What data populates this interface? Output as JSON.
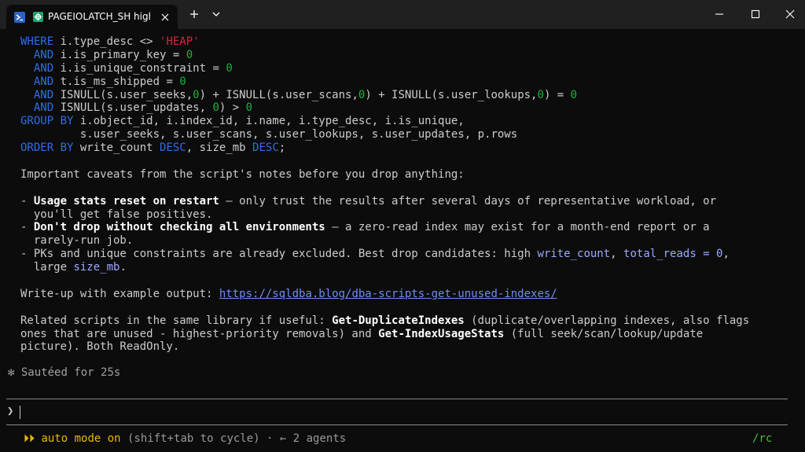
{
  "window": {
    "tab_title": "PAGEIOLATCH_SH high lat",
    "icons": [
      "powershell-icon",
      "task-status-icon",
      "close-icon",
      "plus-icon",
      "chevron-down-icon",
      "minimize-icon",
      "maximize-icon",
      "window-close-icon"
    ]
  },
  "code": [
    [
      [
        "kw",
        "WHERE"
      ],
      [
        "pl",
        " i.type_desc <> "
      ],
      [
        "str",
        "'HEAP'"
      ]
    ],
    [
      [
        "pl",
        "  "
      ],
      [
        "kw",
        "AND"
      ],
      [
        "pl",
        " i.is_primary_key = "
      ],
      [
        "num",
        "0"
      ]
    ],
    [
      [
        "pl",
        "  "
      ],
      [
        "kw",
        "AND"
      ],
      [
        "pl",
        " i.is_unique_constraint = "
      ],
      [
        "num",
        "0"
      ]
    ],
    [
      [
        "pl",
        "  "
      ],
      [
        "kw",
        "AND"
      ],
      [
        "pl",
        " t.is_ms_shipped = "
      ],
      [
        "num",
        "0"
      ]
    ],
    [
      [
        "pl",
        "  "
      ],
      [
        "kw",
        "AND"
      ],
      [
        "pl",
        " ISNULL(s.user_seeks,"
      ],
      [
        "num",
        "0"
      ],
      [
        "pl",
        ") + ISNULL(s.user_scans,"
      ],
      [
        "num",
        "0"
      ],
      [
        "pl",
        ") + ISNULL(s.user_lookups,"
      ],
      [
        "num",
        "0"
      ],
      [
        "pl",
        ") = "
      ],
      [
        "num",
        "0"
      ]
    ],
    [
      [
        "pl",
        "  "
      ],
      [
        "kw",
        "AND"
      ],
      [
        "pl",
        " ISNULL(s.user_updates, "
      ],
      [
        "num",
        "0"
      ],
      [
        "pl",
        ") > "
      ],
      [
        "num",
        "0"
      ]
    ],
    [
      [
        "kw",
        "GROUP BY"
      ],
      [
        "pl",
        " i.object_id, i.index_id, i.name, i.type_desc, i.is_unique,"
      ]
    ],
    [
      [
        "pl",
        "         s.user_seeks, s.user_scans, s.user_lookups, s.user_updates, p.rows"
      ]
    ],
    [
      [
        "kw",
        "ORDER BY"
      ],
      [
        "pl",
        " write_count "
      ],
      [
        "kw",
        "DESC"
      ],
      [
        "pl",
        ", size_mb "
      ],
      [
        "kw",
        "DESC"
      ],
      [
        "pl",
        ";"
      ]
    ],
    [],
    [
      [
        "pl",
        "Important caveats from the script's notes before you drop anything:"
      ]
    ],
    [],
    [
      [
        "pl",
        "- "
      ],
      [
        "bold",
        "Usage stats reset on restart"
      ],
      [
        "pl",
        " — only trust the results after several days of representative workload, or"
      ]
    ],
    [
      [
        "pl",
        "  you'll get false positives."
      ]
    ],
    [
      [
        "pl",
        "- "
      ],
      [
        "bold",
        "Don't drop without checking all environments"
      ],
      [
        "pl",
        " — a zero-read index may exist for a month-end report or a"
      ]
    ],
    [
      [
        "pl",
        "  rarely-run job."
      ]
    ],
    [
      [
        "pl",
        "- PKs and unique constraints are already excluded. Best drop candidates: high "
      ],
      [
        "hl",
        "write_count"
      ],
      [
        "pl",
        ", "
      ],
      [
        "hl",
        "total_reads = 0"
      ],
      [
        "pl",
        ","
      ]
    ],
    [
      [
        "pl",
        "  large "
      ],
      [
        "hl",
        "size_mb"
      ],
      [
        "pl",
        "."
      ]
    ],
    [],
    [
      [
        "pl",
        "Write-up with example output: "
      ],
      [
        "link",
        "https://sqldba.blog/dba-scripts-get-unused-indexes/"
      ]
    ],
    [],
    [
      [
        "pl",
        "Related scripts in the same library if useful: "
      ],
      [
        "bold",
        "Get-DuplicateIndexes"
      ],
      [
        "pl",
        " (duplicate/overlapping indexes, also flags"
      ]
    ],
    [
      [
        "pl",
        "ones that are unused - highest-priority removals) and "
      ],
      [
        "bold",
        "Get-IndexUsageStats"
      ],
      [
        "pl",
        " (full seek/scan/lookup/update"
      ]
    ],
    [
      [
        "pl",
        "picture). Both ReadOnly."
      ]
    ]
  ],
  "status": {
    "glyph": "✻",
    "text": "Sautéed for 25s"
  },
  "prompt": {
    "glyph": "❯",
    "value": ""
  },
  "footer": {
    "arrows": "⏵⏵",
    "mode": "auto mode on",
    "hint": " (shift+tab to cycle) · ← 2 agents",
    "right": "/rc"
  }
}
